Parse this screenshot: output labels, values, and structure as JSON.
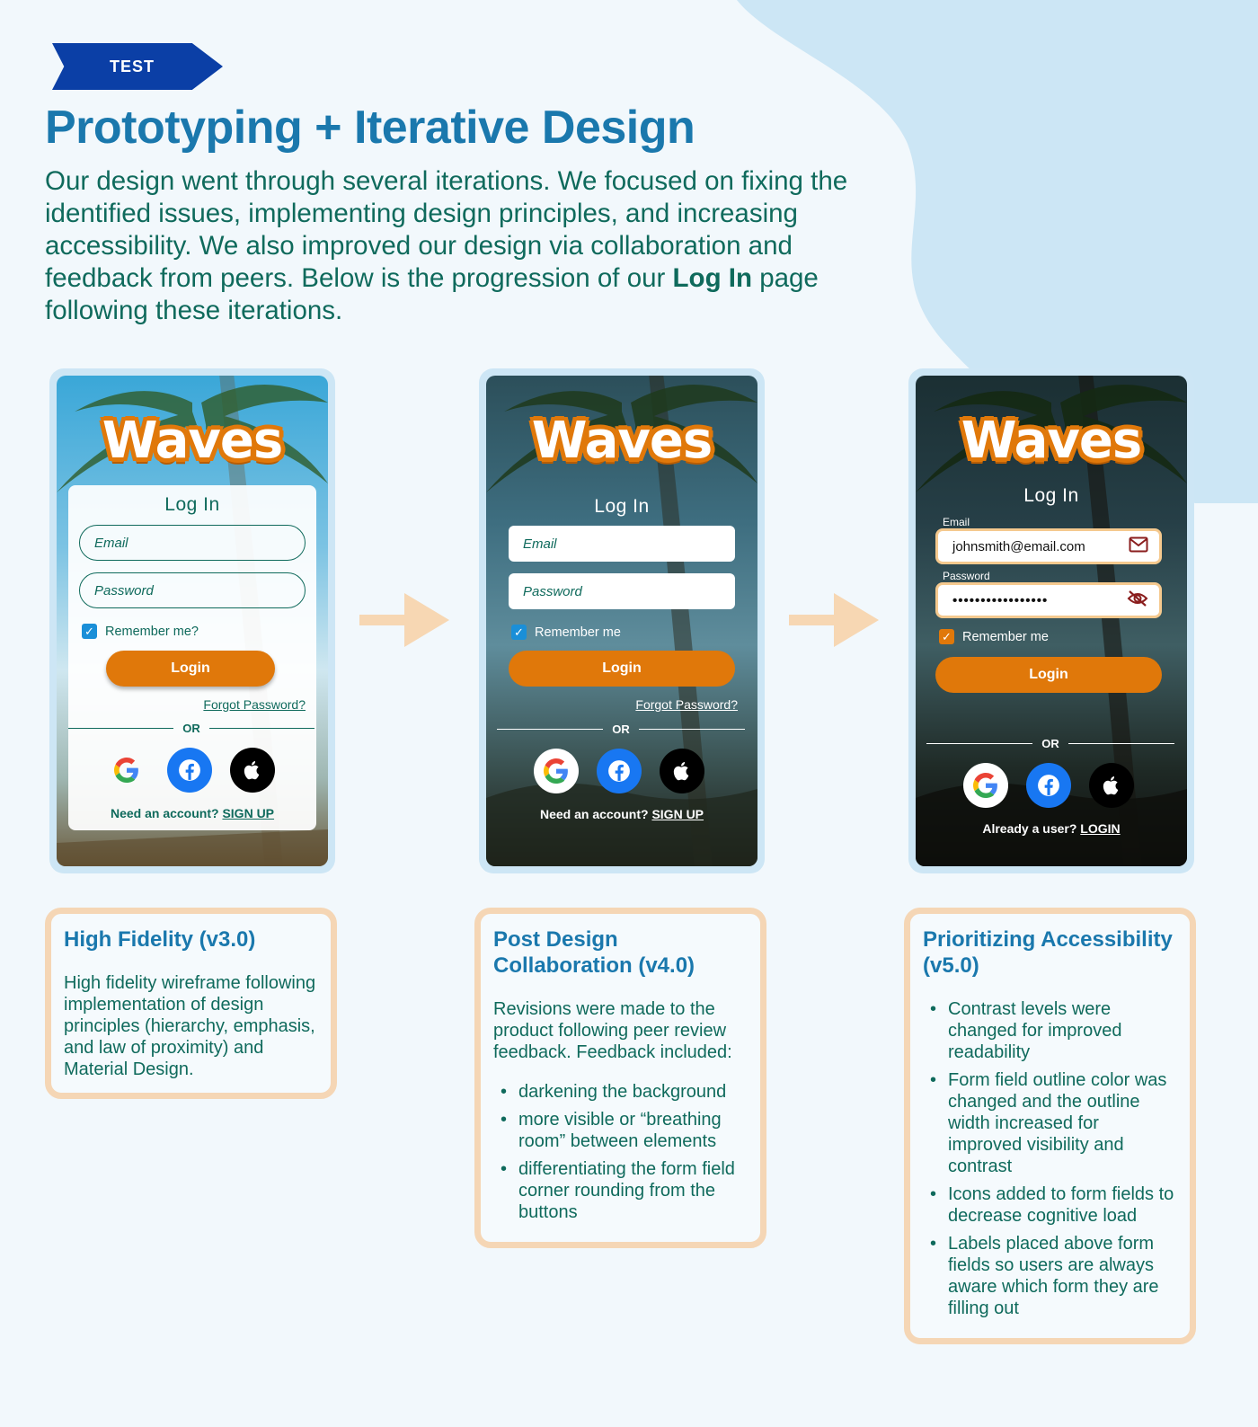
{
  "tag": "TEST",
  "title": "Prototyping + Iterative Design",
  "intro": {
    "before": "Our design went through several iterations. We focused on fixing the identified issues, implementing design principles, and increasing accessibility. We also improved our design via collaboration and feedback from peers. Below is the progression of our ",
    "bold": "Log In",
    "after": " page following these iterations."
  },
  "colors": {
    "accent_blue": "#1a78ad",
    "teal_text": "#0f6a5c",
    "orange": "#e0780a",
    "tag_blue": "#0b3fa6",
    "peach_border": "#f5d6b5"
  },
  "phones": [
    {
      "logo": "Waves",
      "login_title": "Log In",
      "email_placeholder": "Email",
      "password_placeholder": "Password",
      "remember": "Remember me?",
      "login_button": "Login",
      "forgot": "Forgot Password?",
      "or": "OR",
      "account_text": "Need an account?",
      "account_link": "SIGN UP"
    },
    {
      "logo": "Waves",
      "login_title": "Log In",
      "email_placeholder": "Email",
      "password_placeholder": "Password",
      "remember": "Remember me",
      "login_button": "Login",
      "forgot": "Forgot Password?",
      "or": "OR",
      "account_text": "Need an account?",
      "account_link": "SIGN UP"
    },
    {
      "logo": "Waves",
      "login_title": "Log In",
      "email_label": "Email",
      "email_value": "johnsmith@email.com",
      "password_label": "Password",
      "password_value": "•••••••••••••••••",
      "remember": "Remember me",
      "login_button": "Login",
      "or": "OR",
      "account_text": "Already a user?",
      "account_link": "LOGIN"
    }
  ],
  "icons": {
    "google": "google-icon",
    "facebook": "facebook-icon",
    "apple": "apple-icon",
    "mail": "mail-icon",
    "eye_off": "eye-off-icon",
    "arrow": "arrow-right-icon"
  },
  "descriptions": [
    {
      "title": "High Fidelity (v3.0)",
      "text": "High fidelity wireframe following implementation of design principles (hierarchy, emphasis, and law of proximity) and Material Design."
    },
    {
      "title": "Post Design Collaboration (v4.0)",
      "text": "Revisions were made to the product following peer review feedback. Feedback included:",
      "items": [
        "darkening the background",
        "more visible or “breathing room” between elements",
        "differentiating the form field corner rounding from the buttons"
      ]
    },
    {
      "title": "Prioritizing Accessibility (v5.0)",
      "items": [
        "Contrast levels were changed for improved readability",
        "Form field outline color was changed and the outline width increased for improved visibility and contrast",
        "Icons added to form fields to decrease cognitive load",
        "Labels placed above form fields so users are always aware which form they are filling out"
      ]
    }
  ]
}
